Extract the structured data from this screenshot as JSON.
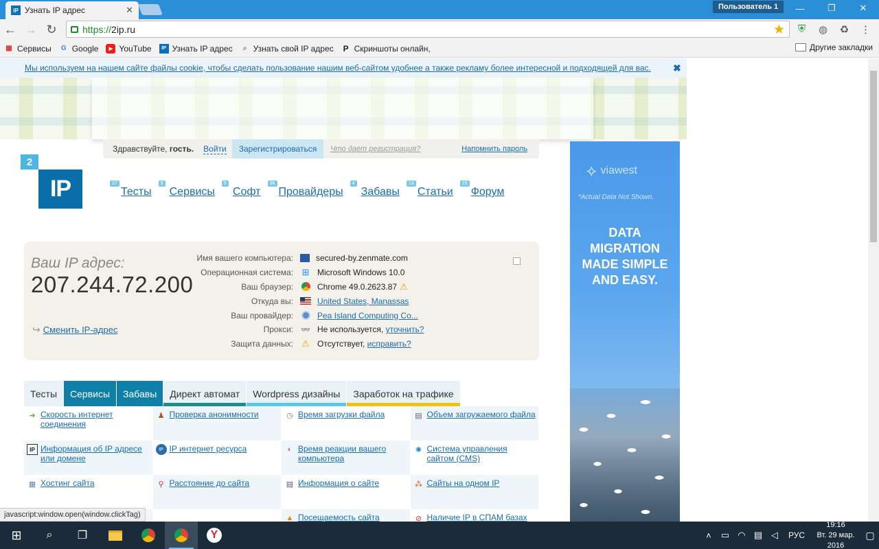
{
  "browser": {
    "tab_title": "Узнать IP адрес",
    "tab_favicon": "IP",
    "tab_close": "✕",
    "user_label": "Пользователь 1",
    "window_buttons": [
      "—",
      "❐",
      "✕"
    ],
    "url_scheme": "https://",
    "url_host": "2ip.ru",
    "bookmarks": [
      {
        "label": "Сервисы",
        "icon": "apps-grid-icon"
      },
      {
        "label": "Google",
        "icon": "google-icon"
      },
      {
        "label": "YouTube",
        "icon": "youtube-icon"
      },
      {
        "label": "Узнать IP адрес",
        "icon": "2ip-icon"
      },
      {
        "label": "Узнать свой IP адрес",
        "icon": "search-icon"
      },
      {
        "label": "Скриншоты онлайн,",
        "icon": "p-icon"
      }
    ],
    "other_bookmarks": "Другие закладки"
  },
  "page": {
    "cookie_text": "Мы используем на нашем сайте файлы cookie, чтобы сделать пользование нашим веб-сайтом удобнее а также рекламу более интересной и подходящей для вас.",
    "cookie_close": "✖",
    "login": {
      "greeting": "Здравствуйте,",
      "guest": "гость.",
      "login_link": "Войти",
      "register": "Зарегистрироваться",
      "what_gives": "Что дает регистрация?",
      "remind": "Напомнить пароль"
    },
    "logo": {
      "small": "2",
      "big": "IP"
    },
    "nav": [
      {
        "badge": "27",
        "label": "Тесты"
      },
      {
        "badge": "9",
        "label": "Сервисы"
      },
      {
        "badge": "5",
        "label": "Софт"
      },
      {
        "badge": "3K",
        "label": "Провайдеры"
      },
      {
        "badge": "4",
        "label": "Забавы"
      },
      {
        "badge": "13",
        "label": "Статьи"
      },
      {
        "badge": "15",
        "label": "Форум"
      }
    ],
    "ip_box": {
      "label": "Ваш IP адрес:",
      "ip": "207.244.72.200",
      "change_ip": "Сменить IP-адрес",
      "rows": [
        {
          "key": "Имя вашего компьютера:",
          "icon": "computer-icon",
          "value": "secured-by.zenmate.com"
        },
        {
          "key": "Операционная система:",
          "icon": "windows-icon",
          "value": "Microsoft Windows 10.0"
        },
        {
          "key": "Ваш браузер:",
          "icon": "chrome-icon",
          "value": "Chrome 49.0.2623.87"
        },
        {
          "key": "Откуда вы:",
          "icon": "us-flag-icon",
          "value": "United States, Manassas"
        },
        {
          "key": "Ваш провайдер:",
          "icon": "provider-icon",
          "value": "Pea Island Computing Co..."
        },
        {
          "key": "Прокси:",
          "icon": "spy-icon",
          "value": "Не используется,",
          "link": "уточнить?"
        },
        {
          "key": "Защита данных:",
          "icon": "warning-icon",
          "value": "Отсутствует,",
          "link": "исправить?"
        }
      ]
    },
    "tabs": [
      {
        "label": "Тесты",
        "color": "#e8f2f7"
      },
      {
        "label": "Сервисы",
        "color": "#0f7fa8"
      },
      {
        "label": "Забавы",
        "color": "#0f7fa8"
      },
      {
        "label": "Директ автомат",
        "color": "#1d8c8c"
      },
      {
        "label": "Wordpress дизайны",
        "color": "#56c9e8"
      },
      {
        "label": "Заработок на трафике",
        "color": "#f2c012"
      }
    ],
    "services": [
      {
        "label": "Скорость интернет соединения",
        "icon": "speed-icon"
      },
      {
        "label": "Проверка анонимности",
        "icon": "anonymity-icon"
      },
      {
        "label": "Время загрузки файла",
        "icon": "clock-icon"
      },
      {
        "label": "Объем загружаемого файла",
        "icon": "file-size-icon"
      },
      {
        "label": "Информация об IP адресе или домене",
        "icon": "ip-info-icon"
      },
      {
        "label": "IP интернет ресурса",
        "icon": "ip-resource-icon"
      },
      {
        "label": "Время реакции вашего компьютера",
        "icon": "reaction-icon"
      },
      {
        "label": "Система управления сайтом (CMS)",
        "icon": "cms-icon"
      },
      {
        "label": "Хостинг сайта",
        "icon": "hosting-icon"
      },
      {
        "label": "Расстояние до сайта",
        "icon": "pin-icon"
      },
      {
        "label": "Информация о сайте",
        "icon": "site-info-icon"
      },
      {
        "label": "Сайты на одном IP",
        "icon": "sites-ip-icon"
      },
      {
        "label": "",
        "icon": ""
      },
      {
        "label": "",
        "icon": ""
      },
      {
        "label": "Посещаемость сайта",
        "icon": "traffic-icon"
      },
      {
        "label": "Наличие IP в СПАМ базах",
        "icon": "spam-icon"
      }
    ],
    "status_link": "javascript:window.open(window.clickTag)",
    "ad": {
      "brand": "viawest",
      "note": "*Actual Data Not Shown.",
      "headline_lines": [
        "DATA",
        "MIGRATION",
        "MADE SIMPLE",
        "AND EASY."
      ]
    }
  },
  "taskbar": {
    "lang": "РУС",
    "time": "19:16",
    "date": "Вт. 29 мар. 2016"
  }
}
